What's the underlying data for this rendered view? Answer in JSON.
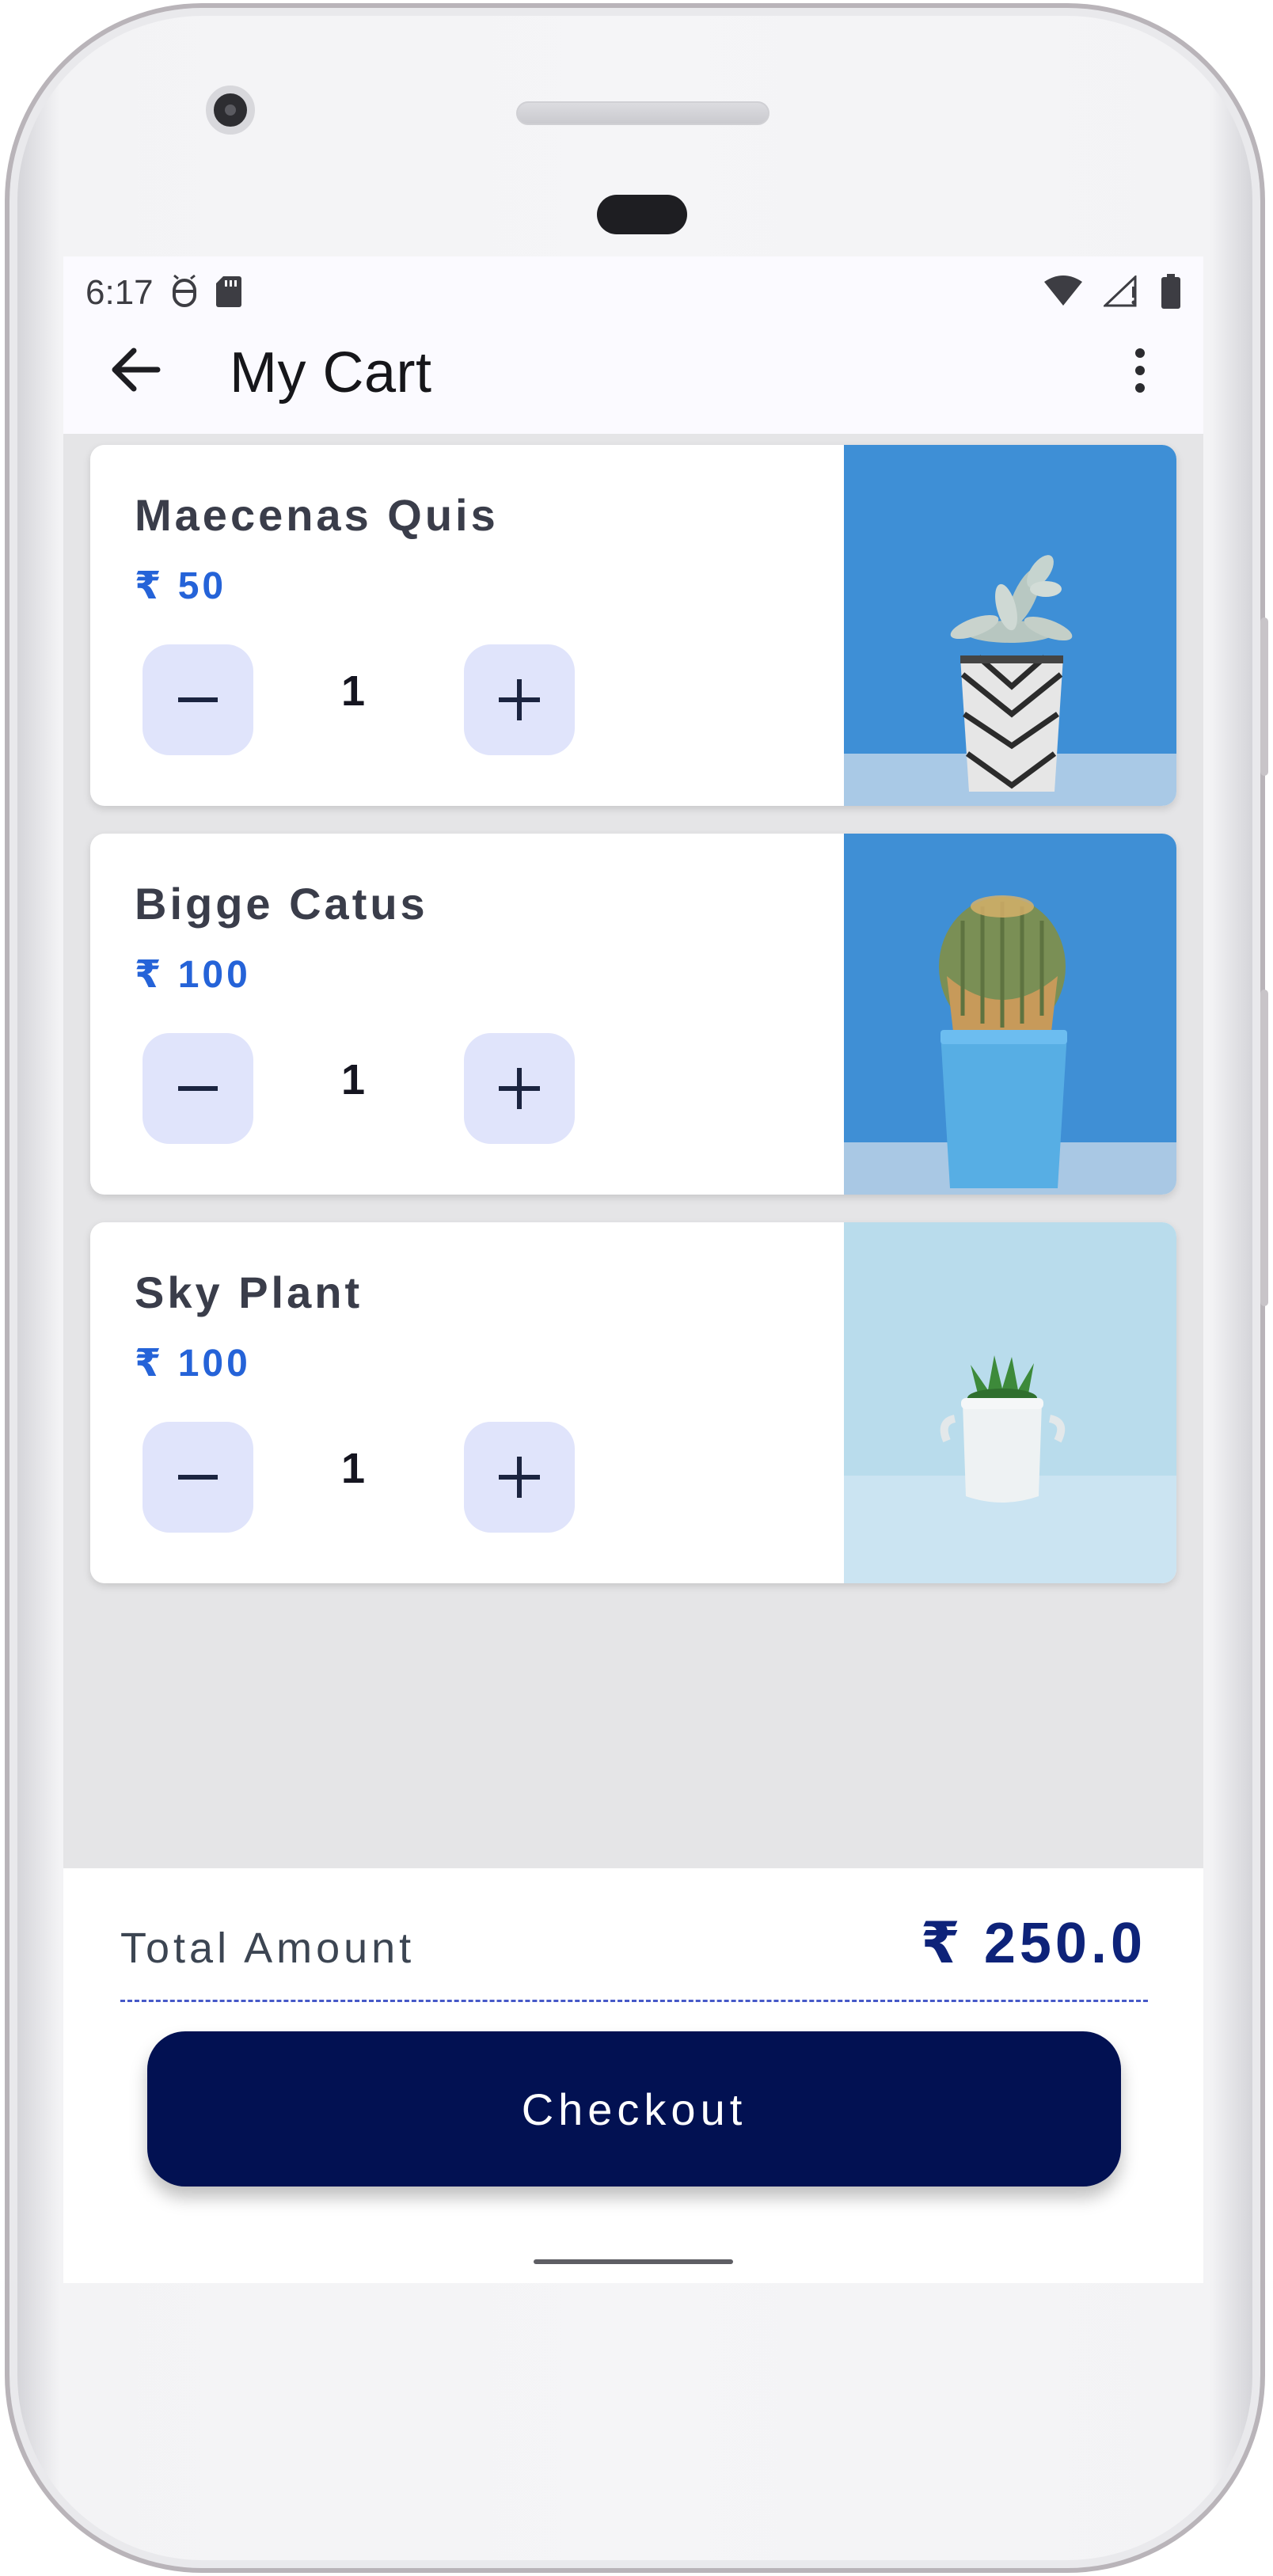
{
  "status_bar": {
    "time": "6:17",
    "left_icons": [
      "usb-debug-icon",
      "sd-card-icon"
    ],
    "right_icons": [
      "wifi-icon",
      "signal-icon",
      "battery-icon"
    ]
  },
  "toolbar": {
    "back_icon": "arrow-left-icon",
    "title": "My Cart",
    "menu_icon": "more-vert-icon"
  },
  "cart_items": [
    {
      "name": "Maecenas Quis",
      "price": "₹ 50",
      "quantity": "1",
      "image": "succulent in patterned black and white pot on blue background"
    },
    {
      "name": "Bigge Catus",
      "price": "₹ 100",
      "quantity": "1",
      "image": "round cactus in light blue pot on blue background"
    },
    {
      "name": "Sky Plant",
      "price": "₹ 100",
      "quantity": "1",
      "image": "small succulent in white jug on pale blue background"
    }
  ],
  "summary": {
    "total_label": "Total Amount",
    "total_value": "₹ 250.0",
    "checkout_label": "Checkout"
  },
  "colors": {
    "accent_price": "#2563d8",
    "qty_button_bg": "#e0e4fb",
    "checkout_bg": "#021152",
    "total_value": "#0e2379"
  }
}
